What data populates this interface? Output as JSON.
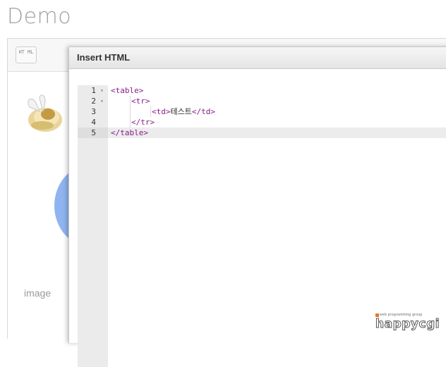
{
  "page": {
    "title": "Demo"
  },
  "toolbar": {
    "html_button": "HT ML"
  },
  "background": {
    "image_label": "image"
  },
  "dialog": {
    "title": "Insert HTML"
  },
  "code_lines": [
    {
      "number": "1",
      "foldable": true,
      "indent": 0,
      "open_tag": "<table>",
      "text": "",
      "close_tag": ""
    },
    {
      "number": "2",
      "foldable": true,
      "indent": 1,
      "open_tag": "<tr>",
      "text": "",
      "close_tag": ""
    },
    {
      "number": "3",
      "foldable": false,
      "indent": 2,
      "open_tag": "<td>",
      "text": "테스트",
      "close_tag": "</td>"
    },
    {
      "number": "4",
      "foldable": false,
      "indent": 1,
      "open_tag": "</tr>",
      "text": "",
      "close_tag": ""
    },
    {
      "number": "5",
      "foldable": false,
      "indent": 0,
      "open_tag": "</table>",
      "text": "",
      "close_tag": "",
      "active": true
    }
  ],
  "watermark": {
    "tagline": "web programming group",
    "brand": "happycgi"
  },
  "colors": {
    "tag": "#8b1c8b",
    "accent_circle": "#8fb4ef",
    "watermark_square": "#e07a2c"
  }
}
